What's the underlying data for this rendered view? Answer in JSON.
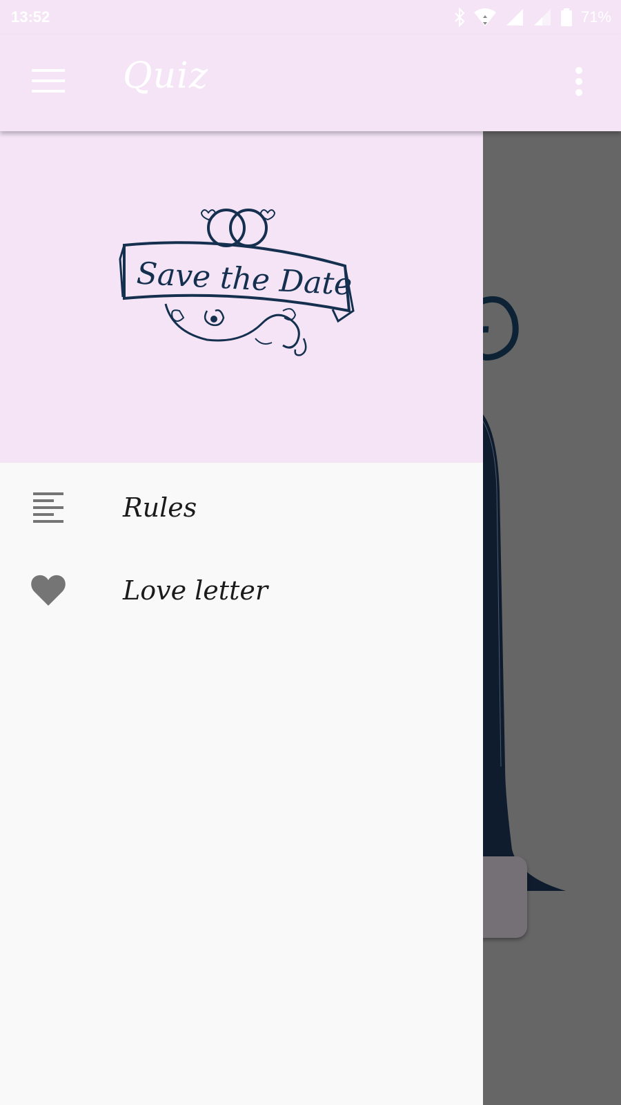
{
  "status_bar": {
    "time": "13:52",
    "battery": "71%",
    "icons": [
      "bluetooth-icon",
      "wifi-icon",
      "signal-icon",
      "signal-icon",
      "battery-icon"
    ]
  },
  "app_bar": {
    "title": "Quiz",
    "menu_icon": "menu-icon",
    "overflow_icon": "more-vert-icon"
  },
  "drawer": {
    "header_logo_text": "Save the Date",
    "items": [
      {
        "label": "Rules",
        "icon": "format-align-left-icon"
      },
      {
        "label": "Love letter",
        "icon": "heart-icon"
      }
    ]
  },
  "colors": {
    "app_bar": "#f4e4f6",
    "drawer_bg": "#f9f9f9",
    "scrim": "#666666",
    "icon_gray": "#757575",
    "logo_navy": "#14304e"
  }
}
